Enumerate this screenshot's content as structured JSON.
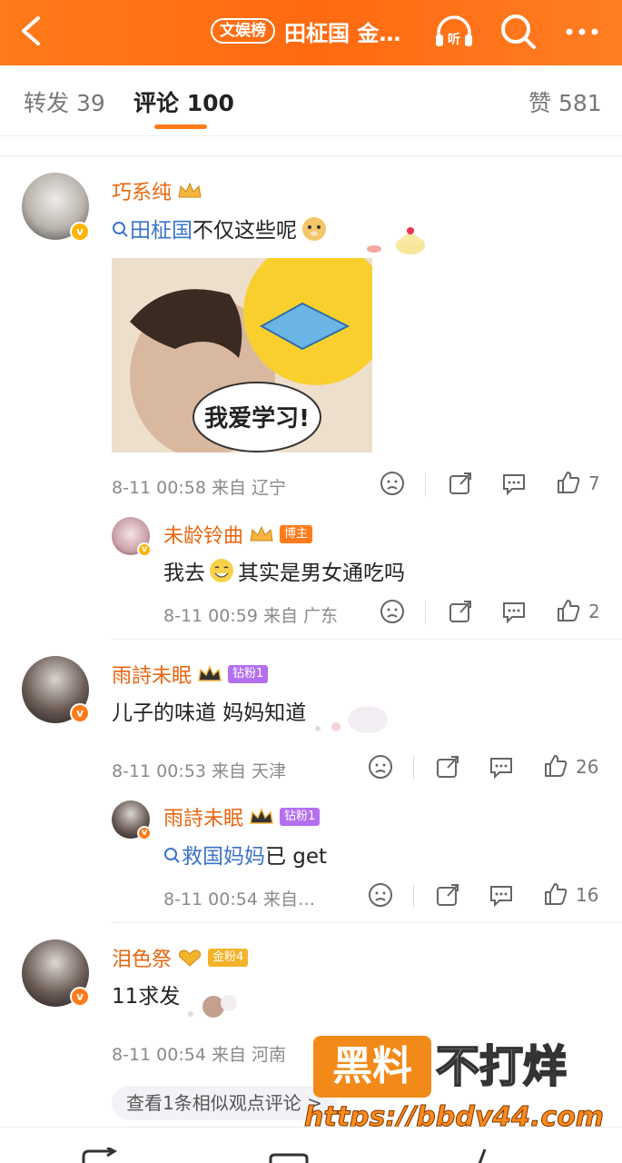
{
  "header": {
    "topic_tag": "文娱榜",
    "title": "田柾国 金…",
    "accent": "#ff7a1a"
  },
  "tabs": {
    "repost": "转发 39",
    "comment_label": "评论",
    "comment_count": "100",
    "likes": "赞 581"
  },
  "comments": [
    {
      "user": "巧系纯",
      "topic": "田柾国",
      "text": "不仅这些呢",
      "image_text": "我爱学习!",
      "time": "8-11 00:58",
      "source": "来自 辽宁",
      "likes": "7",
      "reply": {
        "user": "未龄铃曲",
        "badge": "博主",
        "text_a": "我去",
        "text_b": "其实是男女通吃吗",
        "time": "8-11 00:59",
        "source": "来自 广东",
        "likes": "2"
      }
    },
    {
      "user": "雨詩未眠",
      "badge": "钻粉1",
      "text": "儿子的味道 妈妈知道",
      "time": "8-11 00:53",
      "source": "来自 天津",
      "likes": "26",
      "reply": {
        "user": "雨詩未眠",
        "badge": "钻粉1",
        "topic": "救国妈妈",
        "text": "已 get",
        "time": "8-11 00:54",
        "source": "来自…",
        "likes": "16"
      }
    },
    {
      "user": "泪色祭",
      "badge": "金粉4",
      "text": "11求发",
      "time": "8-11 00:54",
      "source": "来自 河南",
      "more": "查看1条相似观点评论 >"
    }
  ],
  "watermark": {
    "box": "黑料",
    "text": "不打烊",
    "url": "https://bbdy44.com"
  }
}
